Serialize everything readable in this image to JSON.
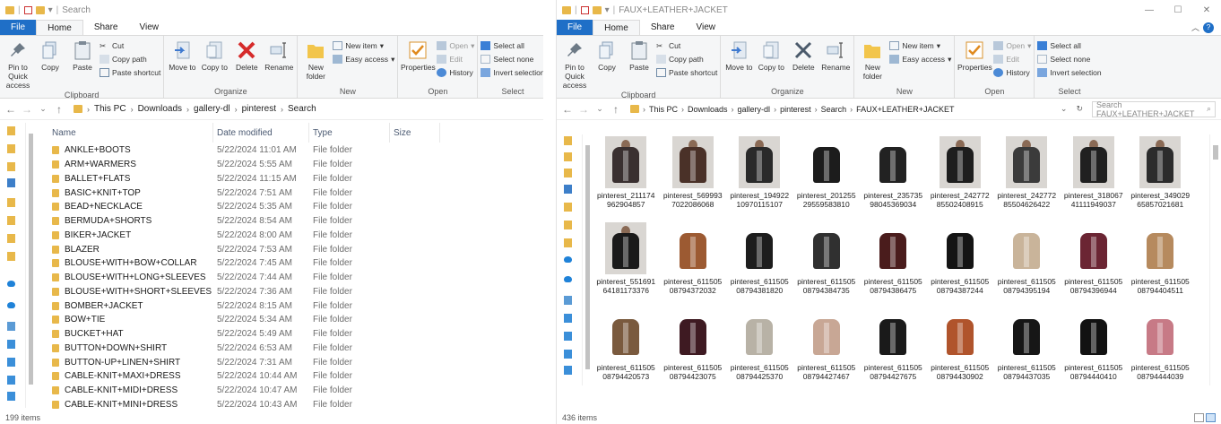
{
  "left": {
    "title": "Search",
    "tabs": [
      "File",
      "Home",
      "Share",
      "View"
    ],
    "ribbon": {
      "clipboard": {
        "pin": "Pin to Quick access",
        "copy": "Copy",
        "paste": "Paste",
        "cut": "Cut",
        "copy_path": "Copy path",
        "paste_shortcut": "Paste shortcut",
        "label": "Clipboard"
      },
      "organize": {
        "move_to": "Move to",
        "copy_to": "Copy to",
        "delete": "Delete",
        "rename": "Rename",
        "label": "Organize"
      },
      "new": {
        "new_folder": "New folder",
        "new_item": "New item",
        "easy_access": "Easy access",
        "label": "New"
      },
      "open": {
        "properties": "Properties",
        "open": "Open",
        "edit": "Edit",
        "history": "History",
        "label": "Open"
      },
      "select": {
        "select_all": "Select all",
        "select_none": "Select none",
        "invert": "Invert selection",
        "label": "Select"
      }
    },
    "breadcrumb": [
      "This PC",
      "Downloads",
      "gallery-dl",
      "pinterest",
      "Search"
    ],
    "columns": {
      "name": "Name",
      "date": "Date modified",
      "type": "Type",
      "size": "Size"
    },
    "files": [
      {
        "name": "ANKLE+BOOTS",
        "date": "5/22/2024 11:01 AM",
        "type": "File folder"
      },
      {
        "name": "ARM+WARMERS",
        "date": "5/22/2024 5:55 AM",
        "type": "File folder"
      },
      {
        "name": "BALLET+FLATS",
        "date": "5/22/2024 11:15 AM",
        "type": "File folder"
      },
      {
        "name": "BASIC+KNIT+TOP",
        "date": "5/22/2024 7:51 AM",
        "type": "File folder"
      },
      {
        "name": "BEAD+NECKLACE",
        "date": "5/22/2024 5:35 AM",
        "type": "File folder"
      },
      {
        "name": "BERMUDA+SHORTS",
        "date": "5/22/2024 8:54 AM",
        "type": "File folder"
      },
      {
        "name": "BIKER+JACKET",
        "date": "5/22/2024 8:00 AM",
        "type": "File folder"
      },
      {
        "name": "BLAZER",
        "date": "5/22/2024 7:53 AM",
        "type": "File folder"
      },
      {
        "name": "BLOUSE+WITH+BOW+COLLAR",
        "date": "5/22/2024 7:45 AM",
        "type": "File folder"
      },
      {
        "name": "BLOUSE+WITH+LONG+SLEEVES",
        "date": "5/22/2024 7:44 AM",
        "type": "File folder"
      },
      {
        "name": "BLOUSE+WITH+SHORT+SLEEVES",
        "date": "5/22/2024 7:36 AM",
        "type": "File folder"
      },
      {
        "name": "BOMBER+JACKET",
        "date": "5/22/2024 8:15 AM",
        "type": "File folder"
      },
      {
        "name": "BOW+TIE",
        "date": "5/22/2024 5:34 AM",
        "type": "File folder"
      },
      {
        "name": "BUCKET+HAT",
        "date": "5/22/2024 5:49 AM",
        "type": "File folder"
      },
      {
        "name": "BUTTON+DOWN+SHIRT",
        "date": "5/22/2024 6:53 AM",
        "type": "File folder"
      },
      {
        "name": "BUTTON-UP+LINEN+SHIRT",
        "date": "5/22/2024 7:31 AM",
        "type": "File folder"
      },
      {
        "name": "CABLE-KNIT+MAXI+DRESS",
        "date": "5/22/2024 10:44 AM",
        "type": "File folder"
      },
      {
        "name": "CABLE-KNIT+MIDI+DRESS",
        "date": "5/22/2024 10:47 AM",
        "type": "File folder"
      },
      {
        "name": "CABLE-KNIT+MINI+DRESS",
        "date": "5/22/2024 10:43 AM",
        "type": "File folder"
      }
    ],
    "status": "199 items"
  },
  "right": {
    "title": "FAUX+LEATHER+JACKET",
    "tabs": [
      "File",
      "Home",
      "Share",
      "View"
    ],
    "breadcrumb": [
      "This PC",
      "Downloads",
      "gallery-dl",
      "pinterest",
      "Search",
      "FAUX+LEATHER+JACKET"
    ],
    "search_placeholder": "Search FAUX+LEATHER+JACKET",
    "thumbnails": [
      {
        "l1": "pinterest_211174",
        "l2": "962904857",
        "color": "#3a3030",
        "person": true
      },
      {
        "l1": "pinterest_569993",
        "l2": "7022086068",
        "color": "#4a3128",
        "person": true
      },
      {
        "l1": "pinterest_194922",
        "l2": "10970115107",
        "color": "#2a2a2a",
        "person": true
      },
      {
        "l1": "pinterest_201255",
        "l2": "29559583810",
        "color": "#1c1c1c",
        "person": false
      },
      {
        "l1": "pinterest_235735",
        "l2": "98045369034",
        "color": "#222222",
        "person": false
      },
      {
        "l1": "pinterest_242772",
        "l2": "85502408915",
        "color": "#1e1e1e",
        "person": true
      },
      {
        "l1": "pinterest_242772",
        "l2": "85504626422",
        "color": "#3b3b3b",
        "person": true
      },
      {
        "l1": "pinterest_318067",
        "l2": "41111949037",
        "color": "#202020",
        "person": true
      },
      {
        "l1": "pinterest_349029",
        "l2": "65857021681",
        "color": "#2c2c2c",
        "person": true
      },
      {
        "l1": "pinterest_551691",
        "l2": "64181173376",
        "color": "#1a1a1a",
        "person": true
      },
      {
        "l1": "pinterest_611505",
        "l2": "08794372032",
        "color": "#9c5a32",
        "person": false
      },
      {
        "l1": "pinterest_611505",
        "l2": "08794381820",
        "color": "#1d1d1d",
        "person": false
      },
      {
        "l1": "pinterest_611505",
        "l2": "08794384735",
        "color": "#303030",
        "person": false
      },
      {
        "l1": "pinterest_611505",
        "l2": "08794386475",
        "color": "#4a1c1c",
        "person": false
      },
      {
        "l1": "pinterest_611505",
        "l2": "08794387244",
        "color": "#141414",
        "person": false
      },
      {
        "l1": "pinterest_611505",
        "l2": "08794395194",
        "color": "#c9b49a",
        "person": false
      },
      {
        "l1": "pinterest_611505",
        "l2": "08794396944",
        "color": "#6b2533",
        "person": false
      },
      {
        "l1": "pinterest_611505",
        "l2": "08794404511",
        "color": "#b68a5e",
        "person": false
      },
      {
        "l1": "pinterest_611505",
        "l2": "08794420573",
        "color": "#7a5a3e",
        "person": false
      },
      {
        "l1": "pinterest_611505",
        "l2": "08794423075",
        "color": "#3e1a22",
        "person": false
      },
      {
        "l1": "pinterest_611505",
        "l2": "08794425370",
        "color": "#b8b2a6",
        "person": false
      },
      {
        "l1": "pinterest_611505",
        "l2": "08794427467",
        "color": "#c8a795",
        "person": false
      },
      {
        "l1": "pinterest_611505",
        "l2": "08794427675",
        "color": "#1a1a1a",
        "person": false
      },
      {
        "l1": "pinterest_611505",
        "l2": "08794430902",
        "color": "#b0542c",
        "person": false
      },
      {
        "l1": "pinterest_611505",
        "l2": "08794437035",
        "color": "#161616",
        "person": false
      },
      {
        "l1": "pinterest_611505",
        "l2": "08794440410",
        "color": "#121212",
        "person": false
      },
      {
        "l1": "pinterest_611505",
        "l2": "08794444039",
        "color": "#c77a86",
        "person": false
      }
    ],
    "status": "436 items"
  }
}
